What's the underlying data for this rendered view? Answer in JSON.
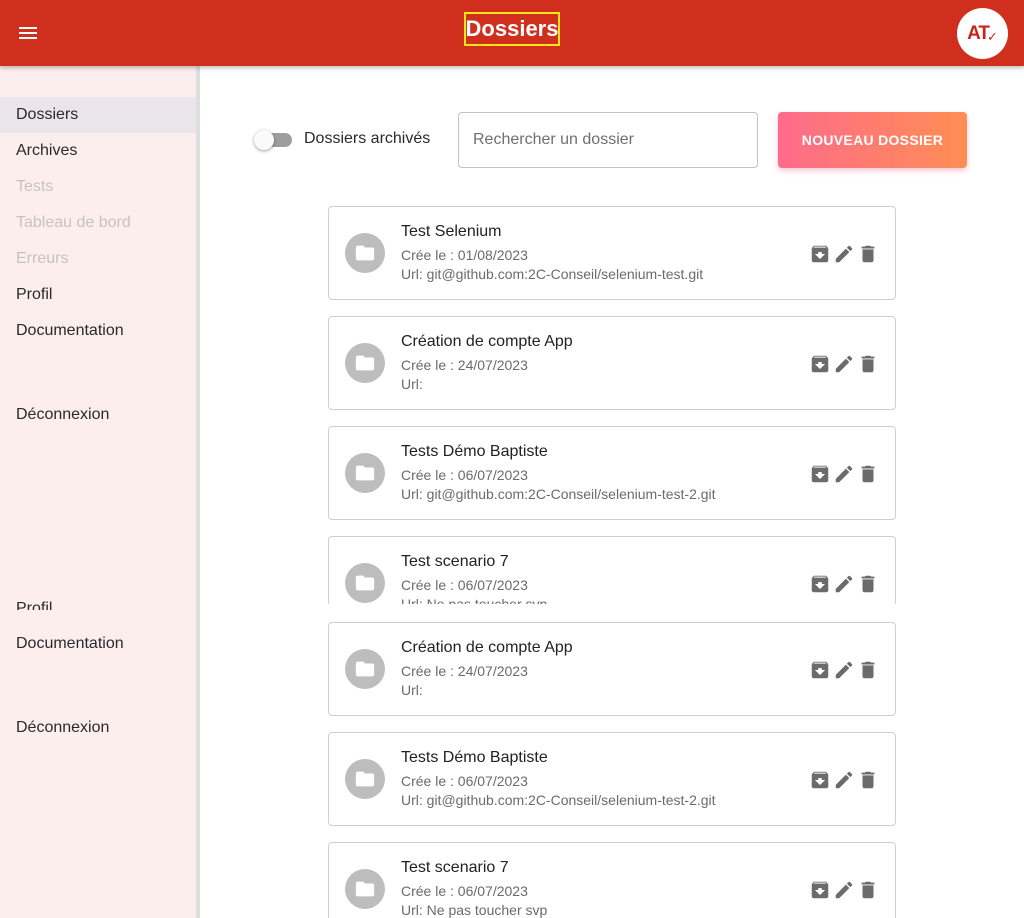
{
  "header": {
    "title": "Dossiers",
    "logo_text": "AT",
    "logo_mark": "✓"
  },
  "sidebar": {
    "items": [
      {
        "label": "Dossiers"
      },
      {
        "label": "Archives"
      },
      {
        "label": "Tests"
      },
      {
        "label": "Tableau de bord"
      },
      {
        "label": "Erreurs"
      },
      {
        "label": "Profil"
      },
      {
        "label": "Documentation"
      },
      {
        "label": "Déconnexion"
      }
    ],
    "repeat_items": [
      {
        "label": "Profil"
      },
      {
        "label": "Documentation"
      },
      {
        "label": "Déconnexion"
      }
    ]
  },
  "toolbar": {
    "archived_toggle_label": "Dossiers archivés",
    "search_placeholder": "Rechercher un dossier",
    "new_button_label": "NOUVEAU DOSSIER"
  },
  "cards": [
    {
      "title": "Test Selenium",
      "date": "Crée le : 01/08/2023",
      "url": "Url: git@github.com:2C-Conseil/selenium-test.git"
    },
    {
      "title": "Création de compte App",
      "date": "Crée le : 24/07/2023",
      "url": "Url:"
    },
    {
      "title": "Tests Démo Baptiste",
      "date": "Crée le : 06/07/2023",
      "url": "Url: git@github.com:2C-Conseil/selenium-test-2.git"
    },
    {
      "title": "Test scenario 7",
      "date": "Crée le : 06/07/2023",
      "url": "Url: Ne pas toucher svp"
    },
    {
      "title": "Création de compte App",
      "date": "Crée le : 24/07/2023",
      "url": "Url:"
    },
    {
      "title": "Tests Démo Baptiste",
      "date": "Crée le : 06/07/2023",
      "url": "Url: git@github.com:2C-Conseil/selenium-test-2.git"
    },
    {
      "title": "Test scenario 7",
      "date": "Crée le : 06/07/2023",
      "url": "Url: Ne pas toucher svp"
    }
  ],
  "icons": {
    "menu": "menu-icon",
    "folder": "folder-icon",
    "archive": "archive-icon",
    "edit": "pencil-icon",
    "delete": "trash-icon"
  },
  "colors": {
    "header_bg": "#d12f1d",
    "sidebar_bg": "#fbeeed",
    "button_gradient_start": "#fe6b8b",
    "button_gradient_end": "#ff8e53",
    "icon_grey": "#6b6b6b"
  }
}
